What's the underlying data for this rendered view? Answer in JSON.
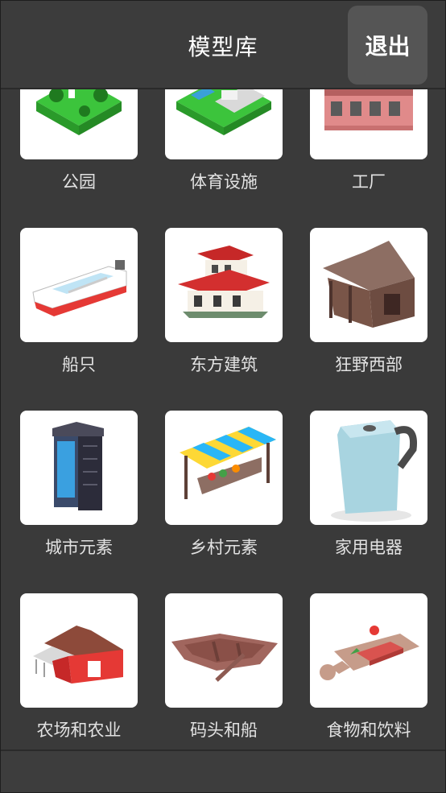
{
  "header": {
    "title": "模型库",
    "exit_label": "退出"
  },
  "categories": [
    {
      "label": "公园",
      "icon": "park-model-icon"
    },
    {
      "label": "体育设施",
      "icon": "sports-facility-model-icon"
    },
    {
      "label": "工厂",
      "icon": "factory-model-icon"
    },
    {
      "label": "船只",
      "icon": "boat-model-icon"
    },
    {
      "label": "东方建筑",
      "icon": "pagoda-model-icon"
    },
    {
      "label": "狂野西部",
      "icon": "wooden-barn-model-icon"
    },
    {
      "label": "城市元素",
      "icon": "phone-booth-model-icon"
    },
    {
      "label": "乡村元素",
      "icon": "market-stall-model-icon"
    },
    {
      "label": "家用电器",
      "icon": "kettle-model-icon"
    },
    {
      "label": "农场和农业",
      "icon": "red-barn-model-icon"
    },
    {
      "label": "码头和船",
      "icon": "rowboat-model-icon"
    },
    {
      "label": "食物和饮料",
      "icon": "cutting-board-food-model-icon"
    }
  ]
}
